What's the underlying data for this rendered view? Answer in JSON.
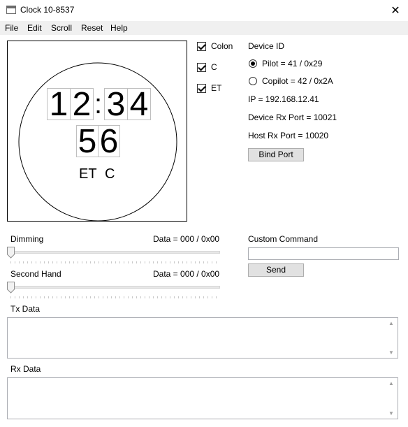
{
  "window": {
    "title": "Clock 10-8537",
    "close_glyph": "✕"
  },
  "menu": [
    "File",
    "Edit",
    "Scroll",
    "Reset",
    "Help"
  ],
  "clock": {
    "hours": [
      "1",
      "2"
    ],
    "colon": ":",
    "minutes": [
      "3",
      "4"
    ],
    "seconds": [
      "5",
      "6"
    ],
    "label_et": "ET",
    "label_c": "C"
  },
  "options": {
    "colon": {
      "label": "Colon",
      "checked": true
    },
    "c": {
      "label": "C",
      "checked": true
    },
    "et": {
      "label": "ET",
      "checked": true
    }
  },
  "device": {
    "heading": "Device ID",
    "pilot_label": "Pilot = 41 / 0x29",
    "copilot_label": "Copilot = 42 / 0x2A",
    "selected": "pilot",
    "ip": "IP = 192.168.12.41",
    "device_rx_port": "Device Rx Port = 10021",
    "host_rx_port": "Host Rx Port = 10020",
    "bind_button": "Bind Port"
  },
  "dimming": {
    "label": "Dimming",
    "data": "Data = 000 / 0x00",
    "value": 0
  },
  "second_hand": {
    "label": "Second Hand",
    "data": "Data = 000 / 0x00",
    "value": 0
  },
  "custom_command": {
    "label": "Custom Command",
    "value": "",
    "send_button": "Send"
  },
  "tx": {
    "label": "Tx Data",
    "value": ""
  },
  "rx": {
    "label": "Rx Data",
    "value": ""
  }
}
